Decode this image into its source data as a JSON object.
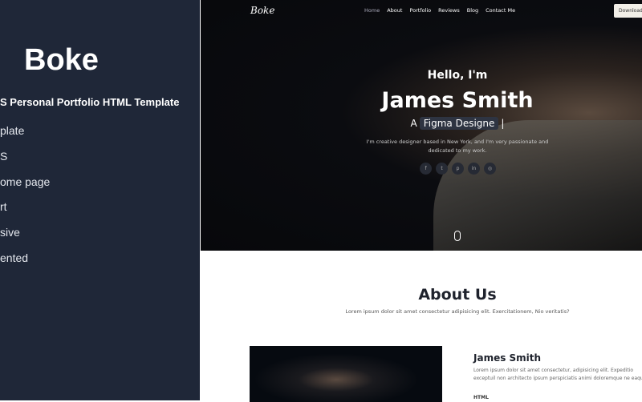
{
  "promo": {
    "brand": "Boke",
    "subtitle": "S Personal Portfolio HTML Template",
    "features": [
      "plate",
      "S",
      "ome page",
      "rt",
      "sive",
      "ented"
    ]
  },
  "site": {
    "logo": "Boke",
    "nav": [
      "Home",
      "About",
      "Portfolio",
      "Reviews",
      "Blog",
      "Contact Me"
    ],
    "download_label": "Download",
    "hero": {
      "greeting": "Hello, I'm",
      "name": "James Smith",
      "role_prefix": "A",
      "role": "Figma Designe",
      "cursor": "|",
      "description": "I'm creative designer based in New York, and I'm very passionate and dedicated to my work.",
      "social": [
        {
          "icon": "facebook-icon",
          "glyph": "f"
        },
        {
          "icon": "twitter-icon",
          "glyph": "t"
        },
        {
          "icon": "pinterest-icon",
          "glyph": "p"
        },
        {
          "icon": "linkedin-icon",
          "glyph": "in"
        },
        {
          "icon": "instagram-icon",
          "glyph": "◎"
        }
      ]
    },
    "about": {
      "title": "About Us",
      "description": "Lorem ipsum dolor sit amet consectetur adipisicing elit. Exercitationem, Nio veritatis?",
      "name": "James Smith",
      "bio": "Lorem ipsum dolor sit amet consectetur, adipisicing elit. Expeditio exceptuil non architecto ipsum perspiciatis animi doloremque ne eaque!",
      "skill_label": "HTML"
    }
  }
}
